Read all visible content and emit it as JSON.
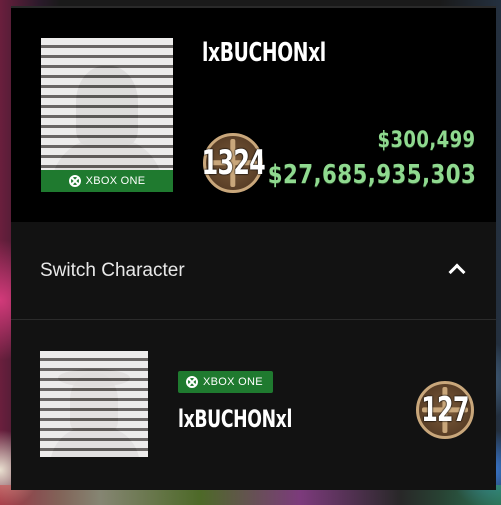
{
  "current_character": {
    "gamertag": "lxBUCHONxl",
    "platform": "XBOX ONE",
    "rank": "1324",
    "cash": "$300,499",
    "bank": "$27,685,935,303",
    "portrait_icon": "character-portrait-mugshot"
  },
  "switch_section": {
    "label": "Switch Character",
    "chevron": "chevron-up-icon"
  },
  "other_characters": [
    {
      "gamertag": "lxBUCHONxl",
      "platform": "XBOX ONE",
      "rank": "127",
      "portrait_icon": "character-portrait-mugshot"
    }
  ],
  "colors": {
    "money_green": "#8fd98f",
    "xbox_green": "#1f7a2f",
    "rank_gold": "#c9a77b",
    "panel_bg": "#121212",
    "top_card_bg": "#000000"
  }
}
